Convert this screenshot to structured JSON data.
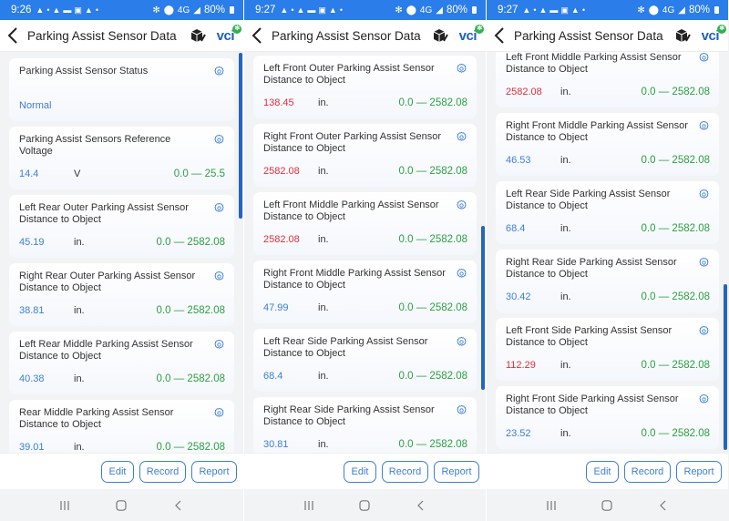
{
  "app_title": "Parking Assist Sensor Data",
  "vci_label": "vci",
  "vci_badge": "•",
  "buttons": {
    "edit": "Edit",
    "record": "Record",
    "report": "Report"
  },
  "status": {
    "network": "4G",
    "battery": "80%"
  },
  "colors": {
    "status_bar": "#2b7de9",
    "value_normal": "#3d7fd6",
    "value_alert": "#e0303a",
    "range": "#2ea043",
    "scrollbar": "#2464c2"
  },
  "screens": [
    {
      "time": "9:26",
      "items": [
        {
          "name": "Parking Assist Sensor Status",
          "value": "Normal",
          "unit": "",
          "range": "",
          "alert": false
        },
        {
          "name": "Parking Assist Sensors Reference Voltage",
          "value": "14.4",
          "unit": "V",
          "range": "0.0 — 25.5",
          "alert": false
        },
        {
          "name": "Left Rear Outer Parking Assist Sensor Distance to Object",
          "value": "45.19",
          "unit": "in.",
          "range": "0.0 — 2582.08",
          "alert": false
        },
        {
          "name": "Right Rear Outer Parking Assist Sensor Distance to Object",
          "value": "38.81",
          "unit": "in.",
          "range": "0.0 — 2582.08",
          "alert": false
        },
        {
          "name": "Left Rear Middle Parking Assist Sensor Distance to Object",
          "value": "40.38",
          "unit": "in.",
          "range": "0.0 — 2582.08",
          "alert": false
        },
        {
          "name": "Rear Middle Parking Assist Sensor Distance to Object",
          "value": "39.01",
          "unit": "in.",
          "range": "0.0 — 2582.08",
          "alert": false
        }
      ]
    },
    {
      "time": "9:27",
      "items": [
        {
          "name": "Left Front Outer Parking Assist Sensor Distance to Object",
          "value": "138.45",
          "unit": "in.",
          "range": "0.0 — 2582.08",
          "alert": true
        },
        {
          "name": "Right Front Outer Parking Assist Sensor Distance to Object",
          "value": "2582.08",
          "unit": "in.",
          "range": "0.0 — 2582.08",
          "alert": true
        },
        {
          "name": "Left Front Middle Parking Assist Sensor Distance to Object",
          "value": "2582.08",
          "unit": "in.",
          "range": "0.0 — 2582.08",
          "alert": true
        },
        {
          "name": "Right Front Middle Parking Assist Sensor Distance to Object",
          "value": "47.99",
          "unit": "in.",
          "range": "0.0 — 2582.08",
          "alert": false
        },
        {
          "name": "Left Rear Side Parking Assist Sensor Distance to Object",
          "value": "68.4",
          "unit": "in.",
          "range": "0.0 — 2582.08",
          "alert": false
        },
        {
          "name": "Right Rear Side Parking Assist Sensor Distance to Object",
          "value": "30.81",
          "unit": "in.",
          "range": "0.0 — 2582.08",
          "alert": false
        }
      ]
    },
    {
      "time": "9:27",
      "items": [
        {
          "name": "Left Front Middle Parking Assist Sensor Distance to Object",
          "value": "2582.08",
          "unit": "in.",
          "range": "0.0 — 2582.08",
          "alert": true
        },
        {
          "name": "Right Front Middle Parking Assist Sensor Distance to Object",
          "value": "46.53",
          "unit": "in.",
          "range": "0.0 — 2582.08",
          "alert": false
        },
        {
          "name": "Left Rear Side Parking Assist Sensor Distance to Object",
          "value": "68.4",
          "unit": "in.",
          "range": "0.0 — 2582.08",
          "alert": false
        },
        {
          "name": "Right Rear Side Parking Assist Sensor Distance to Object",
          "value": "30.42",
          "unit": "in.",
          "range": "0.0 — 2582.08",
          "alert": false
        },
        {
          "name": "Left Front Side Parking Assist Sensor Distance to Object",
          "value": "112.29",
          "unit": "in.",
          "range": "0.0 — 2582.08",
          "alert": true
        },
        {
          "name": "Right Front Side Parking Assist Sensor Distance to Object",
          "value": "23.52",
          "unit": "in.",
          "range": "0.0 — 2582.08",
          "alert": false
        }
      ]
    }
  ]
}
